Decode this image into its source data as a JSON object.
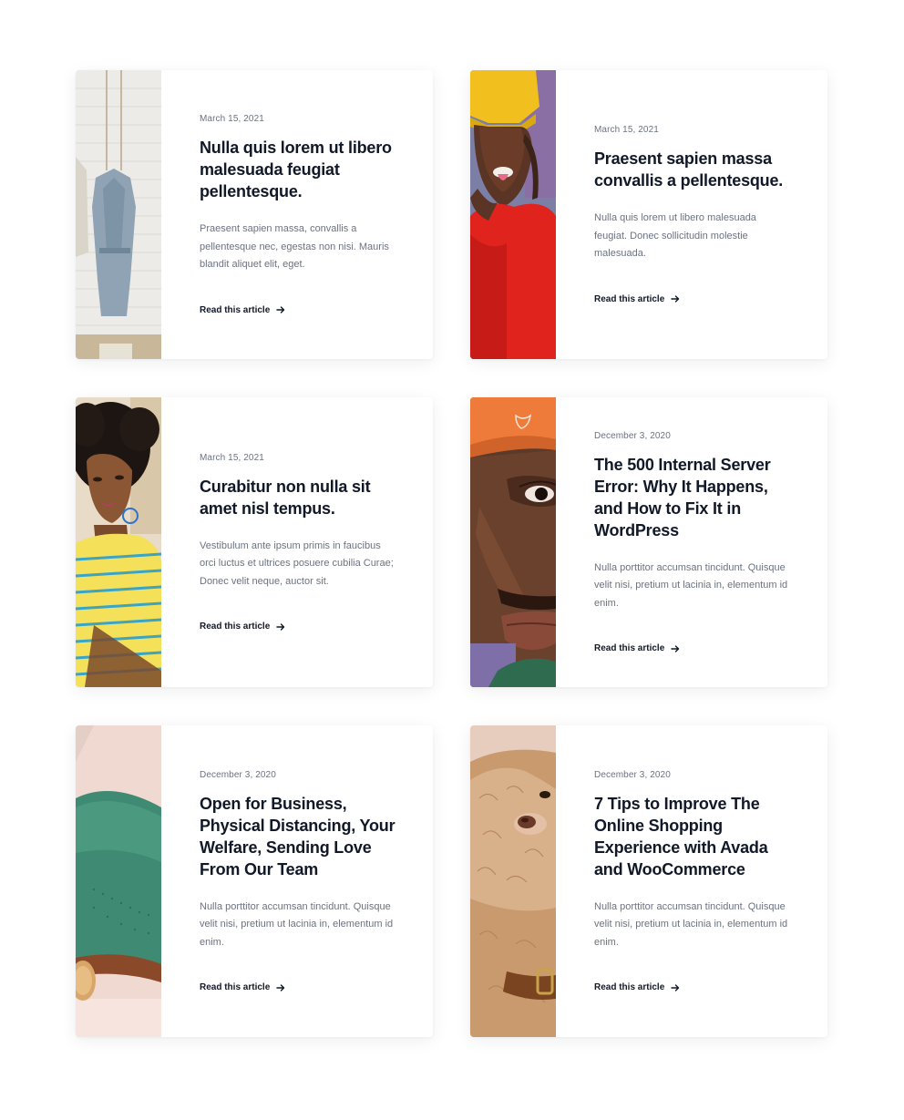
{
  "posts": [
    {
      "date": "March 15, 2021",
      "title": "Nulla quis lorem ut libero malesuada feugiat pellentesque.",
      "excerpt": "Praesent sapien massa, convallis a pellentesque nec, egestas non nisi. Mauris blandit aliquet elit, eget.",
      "link_label": "Read this article",
      "image": "clothing-hanger-photo"
    },
    {
      "date": "March 15, 2021",
      "title": "Praesent sapien massa convallis a pellentesque.",
      "excerpt": "Nulla quis lorem ut libero malesuada feugiat. Donec sollicitudin molestie malesuada.",
      "link_label": "Read this article",
      "image": "woman-yellow-beanie-photo"
    },
    {
      "date": "March 15, 2021",
      "title": "Curabitur non nulla sit amet nisl tempus.",
      "excerpt": "Vestibulum ante ipsum primis in faucibus orci luctus et ultrices posuere cubilia Curae; Donec velit neque, auctor sit.",
      "link_label": "Read this article",
      "image": "woman-striped-shirt-photo"
    },
    {
      "date": "December 3, 2020",
      "title": "The 500 Internal Server Error: Why It Happens, and How to Fix It in WordPress",
      "excerpt": "Nulla porttitor accumsan tincidunt. Quisque velit nisi, pretium ut lacinia in, elementum id enim.",
      "link_label": "Read this article",
      "image": "man-orange-cap-photo"
    },
    {
      "date": "December 3, 2020",
      "title": "Open for Business, Physical Distancing, Your Welfare, Sending Love From Our Team",
      "excerpt": "Nulla porttitor accumsan tincidunt. Quisque velit nisi, pretium ut lacinia in, elementum id enim.",
      "link_label": "Read this article",
      "image": "green-shoe-photo"
    },
    {
      "date": "December 3, 2020",
      "title": "7 Tips to Improve The Online Shopping Experience with Avada and WooCommerce",
      "excerpt": "Nulla porttitor accumsan tincidunt. Quisque velit nisi, pretium ut lacinia in, elementum id enim.",
      "link_label": "Read this article",
      "image": "dog-photo"
    }
  ],
  "colors": {
    "title": "#111827",
    "meta": "#6b7280",
    "card_bg": "#ffffff"
  }
}
